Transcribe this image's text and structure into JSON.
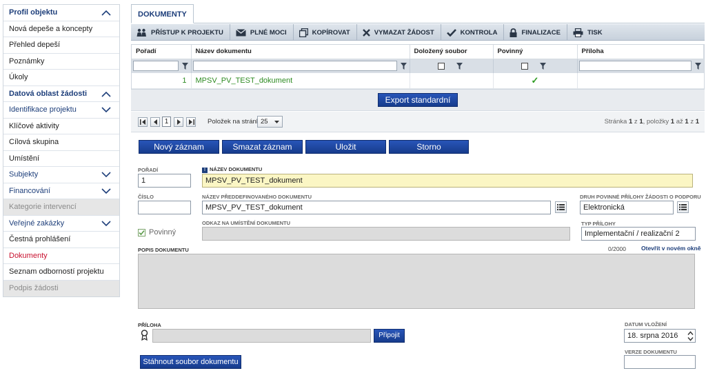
{
  "sidebar": {
    "items": [
      {
        "label": "Profil objektu",
        "kind": "section",
        "chevron": "up"
      },
      {
        "label": "Nová depeše a koncepty",
        "kind": "item"
      },
      {
        "label": "Přehled depeší",
        "kind": "item"
      },
      {
        "label": "Poznámky",
        "kind": "item"
      },
      {
        "label": "Úkoly",
        "kind": "item"
      },
      {
        "label": "Datová oblast žádosti",
        "kind": "section",
        "chevron": "up"
      },
      {
        "label": "Identifikace projektu",
        "kind": "blue",
        "chevron": "down"
      },
      {
        "label": "Klíčové aktivity",
        "kind": "item"
      },
      {
        "label": "Cílová skupina",
        "kind": "item"
      },
      {
        "label": "Umístění",
        "kind": "item"
      },
      {
        "label": "Subjekty",
        "kind": "blue",
        "chevron": "down"
      },
      {
        "label": "Financování",
        "kind": "blue",
        "chevron": "down"
      },
      {
        "label": "Kategorie intervencí",
        "kind": "disabled"
      },
      {
        "label": "Veřejné zakázky",
        "kind": "blue",
        "chevron": "down"
      },
      {
        "label": "Čestná prohlášení",
        "kind": "item"
      },
      {
        "label": "Dokumenty",
        "kind": "active"
      },
      {
        "label": "Seznam odborností projektu",
        "kind": "item"
      },
      {
        "label": "Podpis žádosti",
        "kind": "disabled"
      }
    ]
  },
  "tab": {
    "label": "DOKUMENTY"
  },
  "toolbar": {
    "access": "PŘÍSTUP K PROJEKTU",
    "power": "PLNÉ MOCI",
    "copy": "KOPÍROVAT",
    "delete": "VYMAZAT ŽÁDOST",
    "check": "KONTROLA",
    "finalize": "FINALIZACE",
    "print": "TISK"
  },
  "grid": {
    "headers": [
      "Pořadí",
      "Název dokumentu",
      "Doložený soubor",
      "Povinný",
      "Příloha"
    ],
    "rows": [
      {
        "order": "1",
        "name": "MPSV_PV_TEST_dokument",
        "file": "",
        "required": "✓",
        "attachment": ""
      }
    ],
    "export_label": "Export standardní"
  },
  "pager": {
    "page": "1",
    "per_page_label": "Položek na stránku",
    "per_page": "25",
    "info_prefix": "Stránka",
    "info_page": "1",
    "info_of": "z",
    "info_pages": "1",
    "info_items": ", položky",
    "info_from": "1",
    "info_to_word": "až",
    "info_to": "1",
    "info_of2": "z",
    "info_total": "1"
  },
  "actions": {
    "new": "Nový záznam",
    "delete": "Smazat záznam",
    "save": "Uložit",
    "cancel": "Storno"
  },
  "form": {
    "order_label": "POŘADÍ",
    "order_value": "1",
    "name_label": "NÁZEV DOKUMENTU",
    "name_value": "MPSV_PV_TEST_dokument",
    "number_label": "ČÍSLO",
    "number_value": "",
    "predef_label": "NÁZEV PŘEDDEFINOVANÉHO DOKUMENTU",
    "predef_value": "MPSV_PV_TEST_dokument",
    "kind_label": "DRUH POVINNÉ PŘÍLOHY ŽÁDOSTI O PODPORU",
    "kind_value": "Elektronická",
    "required_label": "Povinný",
    "link_label": "ODKAZ NA UMÍSTĚNÍ DOKUMENTU",
    "link_value": "",
    "type_label": "TYP PŘÍLOHY",
    "type_value": "Implementační / realizační 2",
    "desc_label": "POPIS DOKUMENTU",
    "desc_counter": "0/2000",
    "open_new_window": "Otevřít v novém okně",
    "attachment_label": "PŘÍLOHA",
    "attach_button": "Připojit",
    "date_label": "DATUM VLOŽENÍ",
    "date_value": "18. srpna 2016",
    "version_label": "VERZE DOKUMENTU",
    "version_value": "",
    "download_button": "Stáhnout soubor dokumentu"
  }
}
